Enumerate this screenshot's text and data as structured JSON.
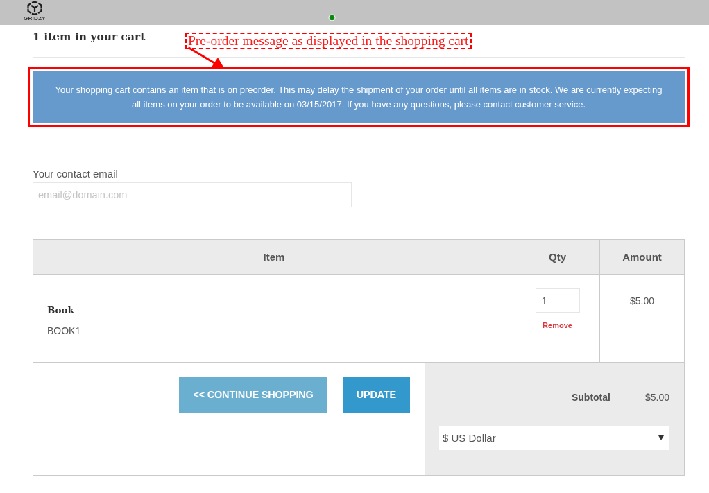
{
  "top_bar": {
    "logo_text": "GRIDZY"
  },
  "cart": {
    "heading": "1 item in your cart"
  },
  "annotation": {
    "text": "Pre-order message as displayed in the shopping cart"
  },
  "preorder_notice": {
    "text": "Your shopping cart contains an item that is on preorder. This may delay the shipment of your order until all items are in stock. We are currently expecting all items on your order to be available on 03/15/2017. If you have any questions, please contact customer service."
  },
  "contact_email": {
    "label": "Your contact email",
    "placeholder": "email@domain.com"
  },
  "table": {
    "columns": [
      "Item",
      "Qty",
      "Amount"
    ],
    "rows": [
      {
        "name": "Book",
        "sku": "BOOK1",
        "qty": "1",
        "remove": "Remove",
        "amount": "$5.00"
      }
    ]
  },
  "actions": [
    {
      "label": "<< CONTINUE SHOPPING",
      "kind": "secondary"
    },
    {
      "label": "UPDATE",
      "kind": "primary"
    }
  ],
  "summary": {
    "subtotal_label": "Subtotal",
    "subtotal": "$5.00",
    "currency": "$ US Dollar"
  }
}
